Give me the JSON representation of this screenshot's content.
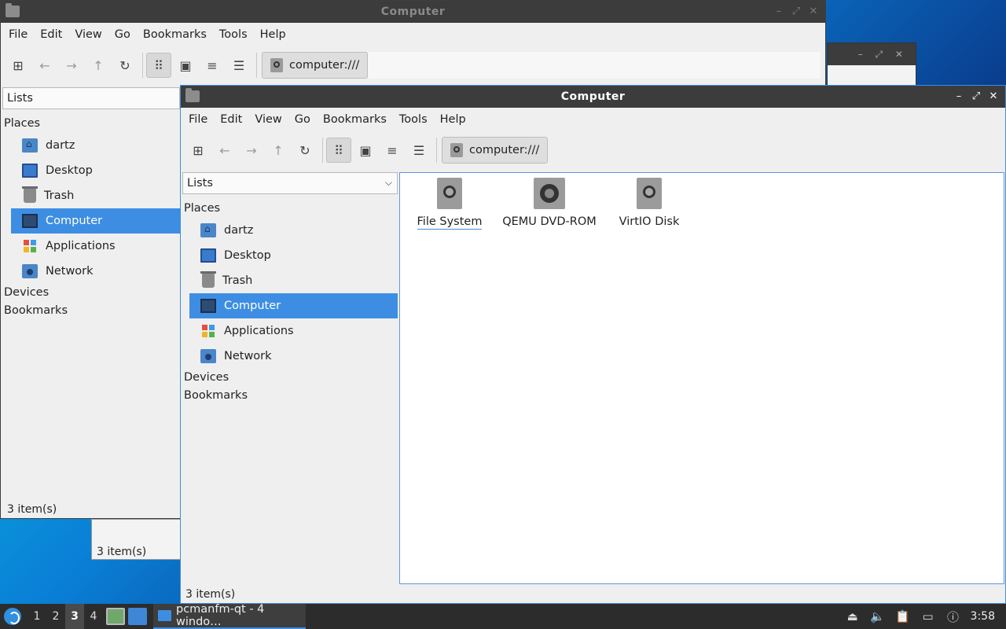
{
  "colors": {
    "accent": "#3d8ee3",
    "titlebar": "#3c3c3c",
    "taskbar": "#2c2c2c"
  },
  "back_window": {
    "title": "Computer",
    "menus": [
      "File",
      "Edit",
      "View",
      "Go",
      "Bookmarks",
      "Tools",
      "Help"
    ],
    "path": "computer:///",
    "side_combo": "Lists",
    "places_header": "Places",
    "places": [
      "dartz",
      "Desktop",
      "Trash",
      "Computer",
      "Applications",
      "Network"
    ],
    "devices_header": "Devices",
    "bookmarks_header": "Bookmarks",
    "status": "3 item(s)"
  },
  "other_window": {
    "status": "3 item(s)"
  },
  "main_window": {
    "title": "Computer",
    "menus": [
      "File",
      "Edit",
      "View",
      "Go",
      "Bookmarks",
      "Tools",
      "Help"
    ],
    "toolbar": {
      "new_tab": "new-tab-icon",
      "back": "arrow-left-icon",
      "forward": "arrow-right-icon",
      "up": "arrow-up-icon",
      "reload": "reload-icon",
      "icon_view": "icon-view-icon",
      "thumb_view": "thumbnail-view-icon",
      "compact_view": "compact-view-icon",
      "detail_view": "detail-view-icon"
    },
    "path": "computer:///",
    "side_combo": "Lists",
    "places_header": "Places",
    "places": [
      "dartz",
      "Desktop",
      "Trash",
      "Computer",
      "Applications",
      "Network"
    ],
    "devices_header": "Devices",
    "bookmarks_header": "Bookmarks",
    "files": [
      "File System",
      "QEMU DVD-ROM",
      "VirtIO Disk"
    ],
    "status": "3 item(s)"
  },
  "taskbar": {
    "workspaces": [
      "1",
      "2",
      "3",
      "4"
    ],
    "task_label": "pcmanfm-qt - 4 windo…",
    "clock": "3:58"
  }
}
